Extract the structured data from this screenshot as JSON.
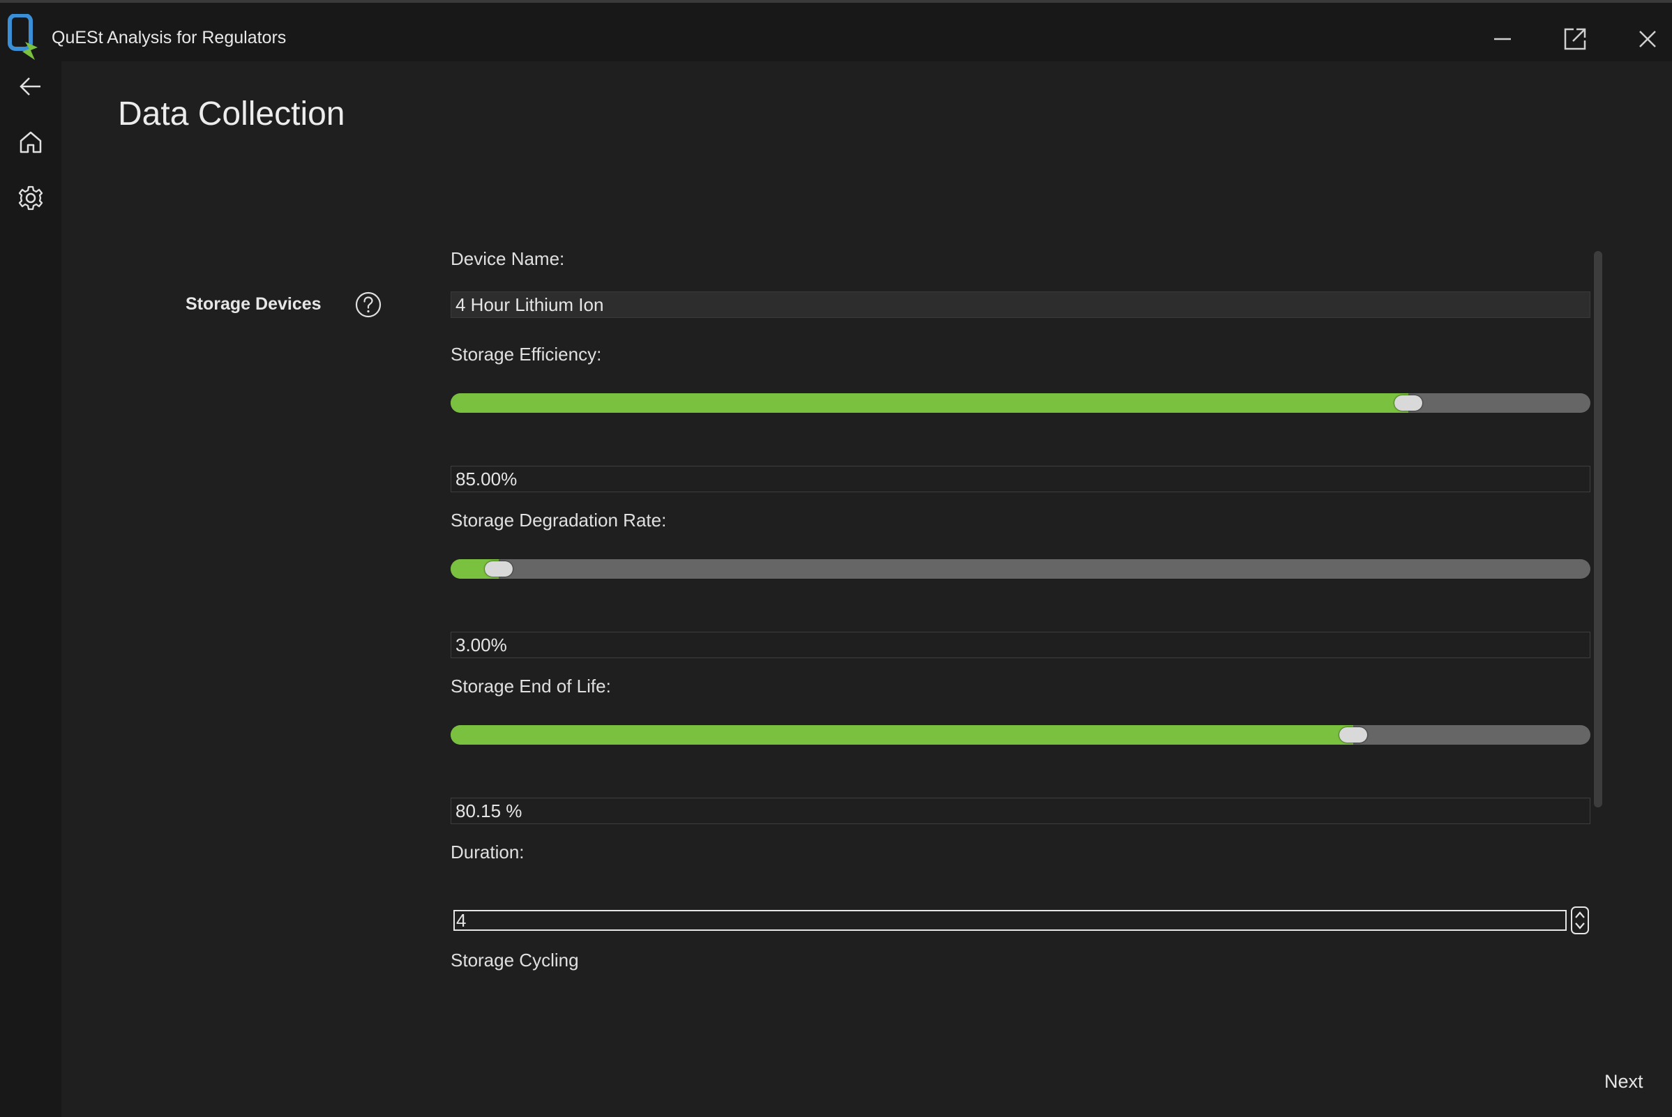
{
  "window": {
    "title": "QuESt Analysis for Regulators",
    "buttons": [
      "minimize-icon",
      "pop-out-icon",
      "close-icon"
    ]
  },
  "sidebar": {
    "items": [
      {
        "name": "back",
        "icon": "arrow-left-icon"
      },
      {
        "name": "home",
        "icon": "home-icon"
      },
      {
        "name": "settings",
        "icon": "gear-icon"
      }
    ]
  },
  "page": {
    "title": "Data Collection",
    "section_label": "Storage Devices",
    "help_icon": "question-circle-icon"
  },
  "form": {
    "device_name": {
      "label": "Device Name:",
      "value": "4 Hour Lithium Ion"
    },
    "storage_efficiency": {
      "label": "Storage Efficiency:",
      "value": "85.00%",
      "slider_fraction": 0.84
    },
    "degradation_rate": {
      "label": "Storage Degradation Rate:",
      "value": "3.00%",
      "slider_fraction": 0.042
    },
    "end_of_life": {
      "label": "Storage End of Life:",
      "value": "80.15 %",
      "slider_fraction": 0.792
    },
    "duration": {
      "label": "Duration:",
      "value": "4"
    },
    "cycling": {
      "label": "Storage Cycling"
    }
  },
  "footer": {
    "next_label": "Next"
  },
  "colors": {
    "accent_green": "#7ac13f",
    "background": "#1f1f1f",
    "titlebar": "#181818",
    "track": "#666666"
  }
}
